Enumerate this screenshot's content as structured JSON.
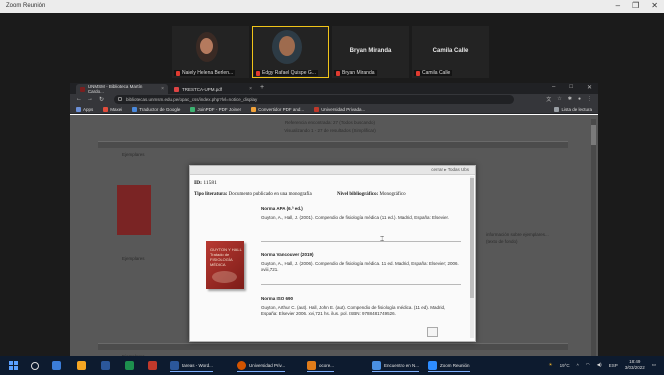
{
  "zoom": {
    "window_title": "Zoom Reunión",
    "controls": [
      "–",
      "❐",
      "✕"
    ],
    "participants": [
      {
        "name": "Naiely Helena Berlen...",
        "muted": true,
        "video": true,
        "active": false
      },
      {
        "name": "Edgy Rafael Quispe G...",
        "muted": true,
        "video": true,
        "active": true
      },
      {
        "name": "Bryan Miranda",
        "label": "Bryan Miranda",
        "muted": true,
        "video": false,
        "active": false
      },
      {
        "name": "Camila Calle",
        "label": "Camila Calle",
        "muted": true,
        "video": false,
        "active": false
      }
    ]
  },
  "browser": {
    "tabs": [
      {
        "label": "UNMSM - Biblioteca Martín Cardo...",
        "active": true,
        "close": "×"
      },
      {
        "label": "TRESTCA-UPM.pdf",
        "active": false,
        "close": "×"
      }
    ],
    "new_tab": "+",
    "window_controls": [
      "–",
      "□",
      "✕"
    ],
    "url": "bibliotecas.unmsm.edu.pe/opac_css/index.php?lvl=notice_display",
    "bookmarks": [
      {
        "label": "Apps",
        "color": "#6b8fd6"
      },
      {
        "label": "Maxei",
        "color": "#e04d3c"
      },
      {
        "label": "Traductor de Google",
        "color": "#4a89dc"
      },
      {
        "label": "JoinPDF - PDF Joiner",
        "color": "#3cb371"
      },
      {
        "label": "Convertidor PDF and...",
        "color": "#f2a33a"
      },
      {
        "label": "Universidad Privada...",
        "color": "#c0392b"
      }
    ],
    "reading_list": "Lista de lectura"
  },
  "page": {
    "header_lines": [
      "Referencia encontrada: 27 (Todos buscando)",
      "Visualizando 1 - 27 de resultados (Simplificar)"
    ],
    "bg_labels": {
      "left_a": "Ejemplares",
      "left_b": "Ejemplares",
      "left_c": "Ejemplares",
      "right": "información sobre ejemplares... (texto de fondo)"
    }
  },
  "modal": {
    "close_label": "cerrar ▸ Todas Ubs",
    "id_label": "ID:",
    "id_value": "11581",
    "type_label": "Tipo literatura:",
    "type_value": "Documento publicado en una monografía",
    "level_label": "Nivel bibliográfico:",
    "level_value": "Monográfico",
    "book_title": "GUYTON Y HALL Tratado de FISIOLOGÍA MÉDICA",
    "citations": [
      {
        "heading": "Norma APA (6.ª ed.)",
        "text": "Guyton, A., Hall, J. (2001). Compendio de fisiología médica (11 ed.). Madrid, España: Elsevier."
      },
      {
        "heading": "Norma Vancouver (2019)",
        "text": "Guyton, A., Hall, J. (2006). Compendio de fisiología médica. 11 ed. Madrid, España: Elsevier; 2006. xviii,721."
      },
      {
        "heading": "Norma ISO 690",
        "text": "Guyton, Arthur C. (aut). Hall, John E. (aut). Compendio de fisiología médica. (11 ed). Madrid, España: Elsevier 2006. xvi,721 hs. ilus. pol. ISBN: 9788481749526."
      }
    ]
  },
  "taskbar": {
    "apps": [
      {
        "label": "",
        "color": "#3b7dd8"
      },
      {
        "label": "",
        "color": "#f5a623"
      },
      {
        "label": "",
        "color": "#2b579a"
      },
      {
        "label": "",
        "color": "#1d8f4e"
      },
      {
        "label": "",
        "color": "#c0392b"
      },
      {
        "label": "tareas - Word...",
        "color": "#2b579a"
      },
      {
        "label": "Universidad Priv...",
        "color": "#d35400"
      },
      {
        "label": "ocore...",
        "color": "#e07c1a"
      },
      {
        "label": "Encuentro en N...",
        "color": "#4a90e2"
      },
      {
        "label": "Zoom Reunión",
        "color": "#2d8cff"
      }
    ],
    "weather": "19°C",
    "language": "ESP",
    "time": "18:49",
    "date": "3/03/2022"
  }
}
